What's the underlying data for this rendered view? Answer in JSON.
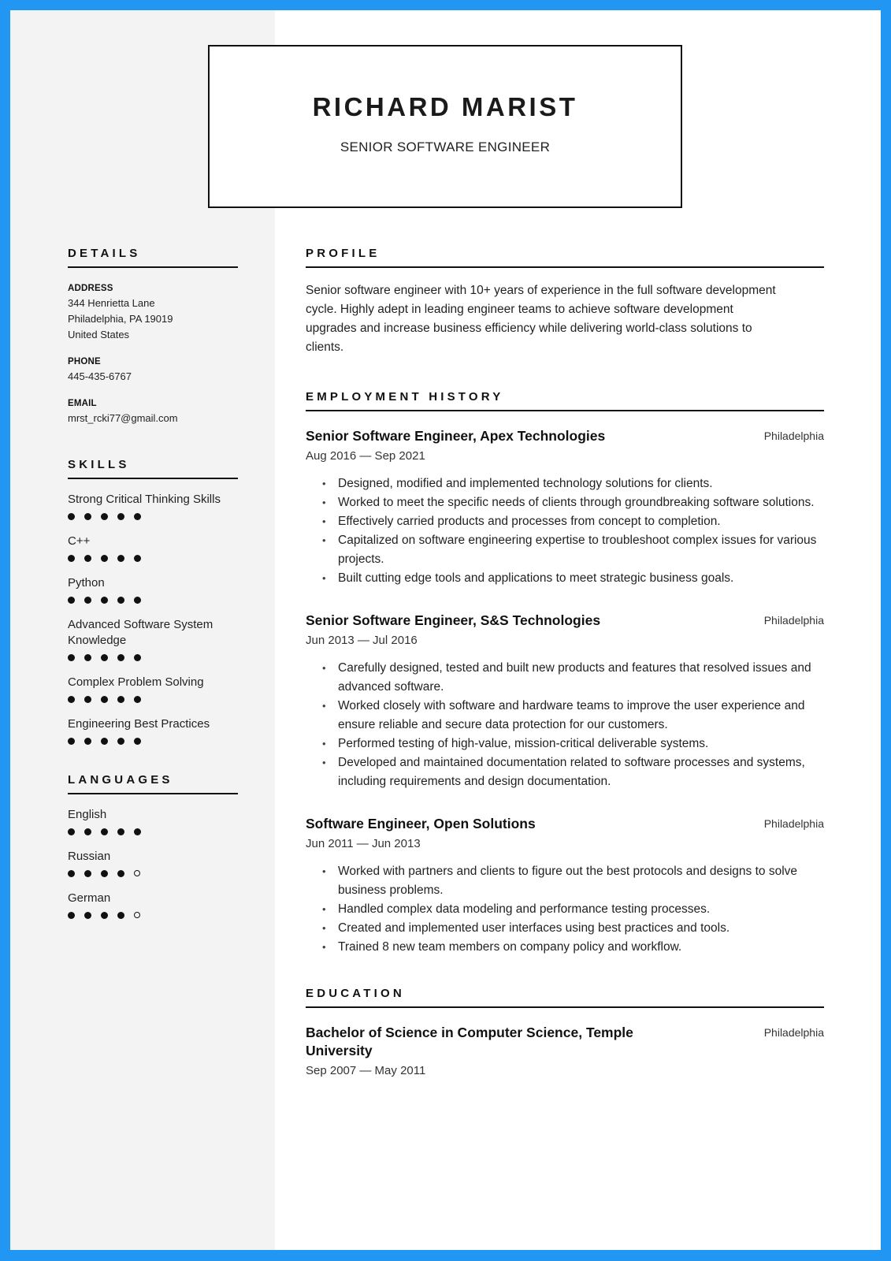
{
  "colors": {
    "frame": "#2196f3",
    "sidebar_bg": "#f3f3f3",
    "text": "#1a1a1a"
  },
  "header": {
    "name": "RICHARD MARIST",
    "job_title": "SENIOR SOFTWARE ENGINEER"
  },
  "sidebar": {
    "details": {
      "heading": "DETAILS",
      "address_label": "ADDRESS",
      "address_lines": [
        "344 Henrietta Lane",
        "Philadelphia, PA 19019",
        "United States"
      ],
      "phone_label": "PHONE",
      "phone": "445-435-6767",
      "email_label": "EMAIL",
      "email": "mrst_rcki77@gmail.com"
    },
    "skills": {
      "heading": "SKILLS",
      "items": [
        {
          "label": "Strong Critical Thinking Skills",
          "rating": 5,
          "max": 5
        },
        {
          "label": "C++",
          "rating": 5,
          "max": 5
        },
        {
          "label": "Python",
          "rating": 5,
          "max": 5
        },
        {
          "label": "Advanced Software System Knowledge",
          "rating": 5,
          "max": 5
        },
        {
          "label": "Complex Problem Solving",
          "rating": 5,
          "max": 5
        },
        {
          "label": "Engineering Best Practices",
          "rating": 5,
          "max": 5
        }
      ]
    },
    "languages": {
      "heading": "LANGUAGES",
      "items": [
        {
          "label": "English",
          "rating": 5,
          "max": 5
        },
        {
          "label": "Russian",
          "rating": 4,
          "max": 5
        },
        {
          "label": "German",
          "rating": 4,
          "max": 5
        }
      ]
    }
  },
  "main": {
    "profile": {
      "heading": "PROFILE",
      "text": "Senior software engineer with 10+ years of experience in the full software development cycle. Highly adept in leading engineer teams to achieve software development upgrades and increase business efficiency while delivering world-class solutions to clients."
    },
    "employment": {
      "heading": "EMPLOYMENT HISTORY",
      "jobs": [
        {
          "title": "Senior Software Engineer, Apex Technologies",
          "location": "Philadelphia",
          "dates": "Aug 2016 — Sep 2021",
          "bullets": [
            "Designed, modified and implemented technology solutions for clients.",
            "Worked to meet the specific needs of clients through groundbreaking software solutions.",
            "Effectively carried products and processes from concept to completion.",
            "Capitalized on software engineering expertise to troubleshoot complex issues for various projects.",
            "Built cutting edge tools and applications to meet strategic business goals."
          ]
        },
        {
          "title": "Senior Software Engineer, S&S Technologies",
          "location": "Philadelphia",
          "dates": "Jun 2013 — Jul 2016",
          "bullets": [
            "Carefully designed, tested and built new products and features that resolved issues and advanced software.",
            "Worked closely with software and hardware teams to improve the user experience and ensure reliable and secure data protection for our customers.",
            "Performed testing of high-value, mission-critical deliverable systems.",
            "Developed and maintained documentation related to software processes and systems, including requirements and design documentation."
          ]
        },
        {
          "title": "Software Engineer, Open Solutions",
          "location": "Philadelphia",
          "dates": "Jun 2011 — Jun 2013",
          "bullets": [
            "Worked with partners and clients to figure out the best protocols and designs to solve business problems.",
            "Handled complex data modeling and performance testing processes.",
            "Created and implemented user interfaces using best practices and tools.",
            "Trained 8 new team members on company policy and workflow."
          ]
        }
      ]
    },
    "education": {
      "heading": "EDUCATION",
      "items": [
        {
          "title": "Bachelor of Science in Computer Science, Temple University",
          "location": "Philadelphia",
          "dates": "Sep 2007 — May 2011"
        }
      ]
    }
  },
  "bullet_glyph": "•"
}
